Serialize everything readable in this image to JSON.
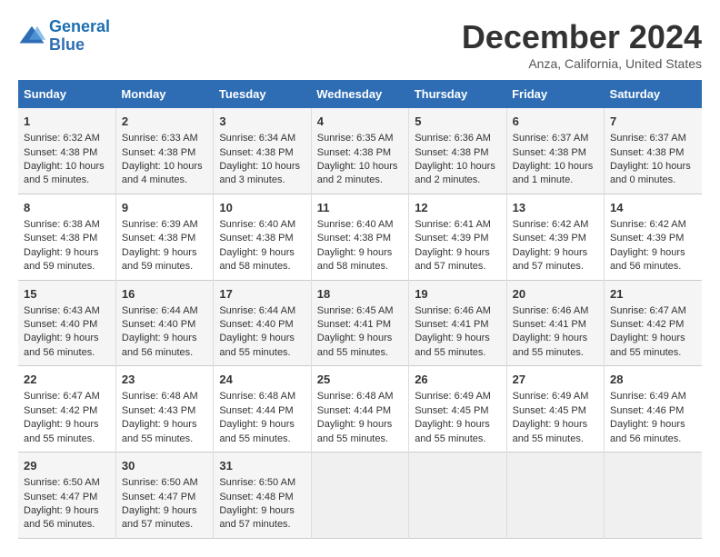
{
  "logo": {
    "line1": "General",
    "line2": "Blue"
  },
  "title": "December 2024",
  "subtitle": "Anza, California, United States",
  "days_header": [
    "Sunday",
    "Monday",
    "Tuesday",
    "Wednesday",
    "Thursday",
    "Friday",
    "Saturday"
  ],
  "weeks": [
    [
      {
        "day": "1",
        "sunrise": "6:32 AM",
        "sunset": "4:38 PM",
        "daylight": "10 hours and 5 minutes."
      },
      {
        "day": "2",
        "sunrise": "6:33 AM",
        "sunset": "4:38 PM",
        "daylight": "10 hours and 4 minutes."
      },
      {
        "day": "3",
        "sunrise": "6:34 AM",
        "sunset": "4:38 PM",
        "daylight": "10 hours and 3 minutes."
      },
      {
        "day": "4",
        "sunrise": "6:35 AM",
        "sunset": "4:38 PM",
        "daylight": "10 hours and 2 minutes."
      },
      {
        "day": "5",
        "sunrise": "6:36 AM",
        "sunset": "4:38 PM",
        "daylight": "10 hours and 2 minutes."
      },
      {
        "day": "6",
        "sunrise": "6:37 AM",
        "sunset": "4:38 PM",
        "daylight": "10 hours and 1 minute."
      },
      {
        "day": "7",
        "sunrise": "6:37 AM",
        "sunset": "4:38 PM",
        "daylight": "10 hours and 0 minutes."
      }
    ],
    [
      {
        "day": "8",
        "sunrise": "6:38 AM",
        "sunset": "4:38 PM",
        "daylight": "9 hours and 59 minutes."
      },
      {
        "day": "9",
        "sunrise": "6:39 AM",
        "sunset": "4:38 PM",
        "daylight": "9 hours and 59 minutes."
      },
      {
        "day": "10",
        "sunrise": "6:40 AM",
        "sunset": "4:38 PM",
        "daylight": "9 hours and 58 minutes."
      },
      {
        "day": "11",
        "sunrise": "6:40 AM",
        "sunset": "4:38 PM",
        "daylight": "9 hours and 58 minutes."
      },
      {
        "day": "12",
        "sunrise": "6:41 AM",
        "sunset": "4:39 PM",
        "daylight": "9 hours and 57 minutes."
      },
      {
        "day": "13",
        "sunrise": "6:42 AM",
        "sunset": "4:39 PM",
        "daylight": "9 hours and 57 minutes."
      },
      {
        "day": "14",
        "sunrise": "6:42 AM",
        "sunset": "4:39 PM",
        "daylight": "9 hours and 56 minutes."
      }
    ],
    [
      {
        "day": "15",
        "sunrise": "6:43 AM",
        "sunset": "4:40 PM",
        "daylight": "9 hours and 56 minutes."
      },
      {
        "day": "16",
        "sunrise": "6:44 AM",
        "sunset": "4:40 PM",
        "daylight": "9 hours and 56 minutes."
      },
      {
        "day": "17",
        "sunrise": "6:44 AM",
        "sunset": "4:40 PM",
        "daylight": "9 hours and 55 minutes."
      },
      {
        "day": "18",
        "sunrise": "6:45 AM",
        "sunset": "4:41 PM",
        "daylight": "9 hours and 55 minutes."
      },
      {
        "day": "19",
        "sunrise": "6:46 AM",
        "sunset": "4:41 PM",
        "daylight": "9 hours and 55 minutes."
      },
      {
        "day": "20",
        "sunrise": "6:46 AM",
        "sunset": "4:41 PM",
        "daylight": "9 hours and 55 minutes."
      },
      {
        "day": "21",
        "sunrise": "6:47 AM",
        "sunset": "4:42 PM",
        "daylight": "9 hours and 55 minutes."
      }
    ],
    [
      {
        "day": "22",
        "sunrise": "6:47 AM",
        "sunset": "4:42 PM",
        "daylight": "9 hours and 55 minutes."
      },
      {
        "day": "23",
        "sunrise": "6:48 AM",
        "sunset": "4:43 PM",
        "daylight": "9 hours and 55 minutes."
      },
      {
        "day": "24",
        "sunrise": "6:48 AM",
        "sunset": "4:44 PM",
        "daylight": "9 hours and 55 minutes."
      },
      {
        "day": "25",
        "sunrise": "6:48 AM",
        "sunset": "4:44 PM",
        "daylight": "9 hours and 55 minutes."
      },
      {
        "day": "26",
        "sunrise": "6:49 AM",
        "sunset": "4:45 PM",
        "daylight": "9 hours and 55 minutes."
      },
      {
        "day": "27",
        "sunrise": "6:49 AM",
        "sunset": "4:45 PM",
        "daylight": "9 hours and 55 minutes."
      },
      {
        "day": "28",
        "sunrise": "6:49 AM",
        "sunset": "4:46 PM",
        "daylight": "9 hours and 56 minutes."
      }
    ],
    [
      {
        "day": "29",
        "sunrise": "6:50 AM",
        "sunset": "4:47 PM",
        "daylight": "9 hours and 56 minutes."
      },
      {
        "day": "30",
        "sunrise": "6:50 AM",
        "sunset": "4:47 PM",
        "daylight": "9 hours and 57 minutes."
      },
      {
        "day": "31",
        "sunrise": "6:50 AM",
        "sunset": "4:48 PM",
        "daylight": "9 hours and 57 minutes."
      },
      null,
      null,
      null,
      null
    ]
  ],
  "labels": {
    "sunrise": "Sunrise:",
    "sunset": "Sunset:",
    "daylight": "Daylight:"
  }
}
